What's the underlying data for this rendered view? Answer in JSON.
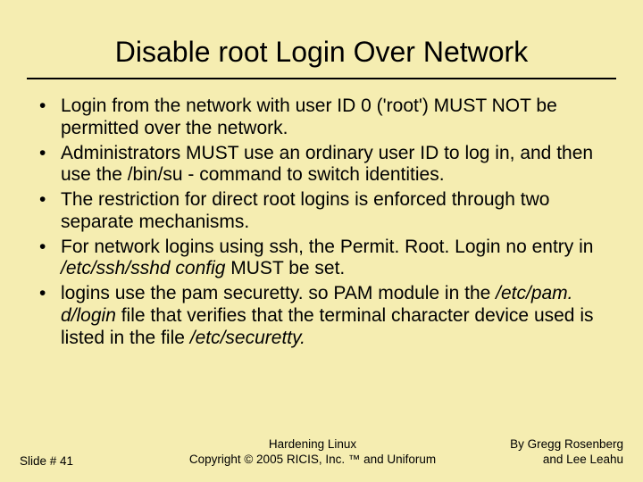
{
  "title": "Disable root Login Over Network",
  "bullets": [
    {
      "pre": "Login from the network with user ID 0 ('root') MUST NOT be permitted over the network.",
      "ital": "",
      "post": ""
    },
    {
      "pre": "Administrators MUST use an ordinary user ID to log in, and then use the /bin/su - command to switch identities.",
      "ital": "",
      "post": ""
    },
    {
      "pre": "The restriction for direct root logins is enforced through two separate mechanisms.",
      "ital": "",
      "post": ""
    },
    {
      "pre": "For network logins using ssh, the Permit. Root. Login no entry in ",
      "ital": "/etc/ssh/sshd config",
      "post": " MUST be set."
    },
    {
      "pre": "logins use the pam securetty. so PAM module in the ",
      "ital": "/etc/pam. d/login",
      "post": " file that verifies that the terminal character device used is listed in the file ",
      "ital2": "/etc/securetty.",
      "post2": ""
    }
  ],
  "footer": {
    "slide": "Slide # 41",
    "center_line1": "Hardening Linux",
    "center_line2": "Copyright © 2005 RICIS, Inc. ™ and Uniforum",
    "authors_line1": "By Gregg Rosenberg",
    "authors_line2": "and Lee Leahu"
  }
}
